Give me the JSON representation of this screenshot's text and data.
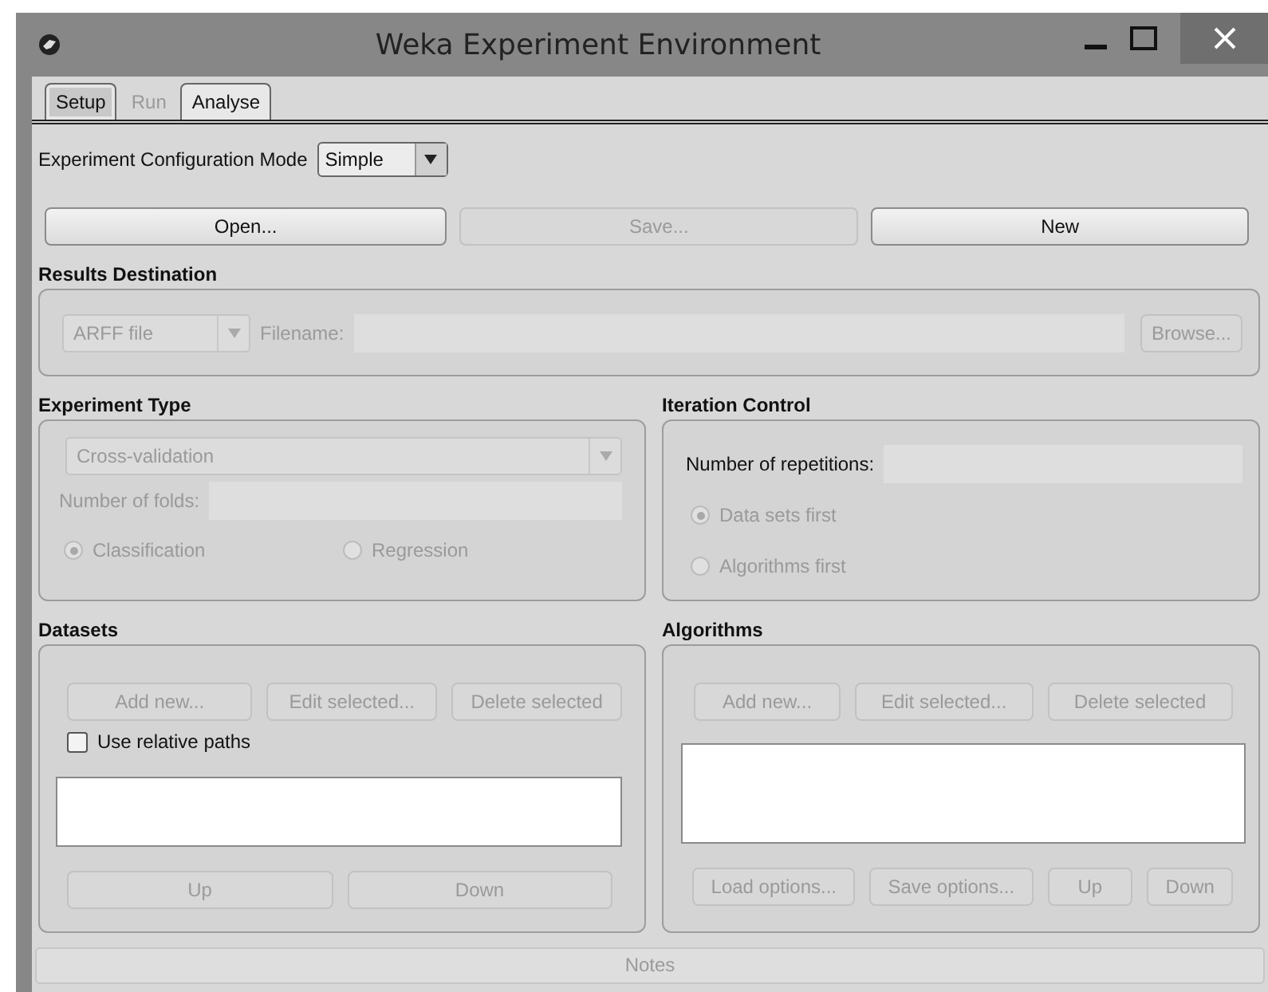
{
  "window": {
    "title": "Weka Experiment Environment"
  },
  "tabs": [
    {
      "label": "Setup",
      "selected": true,
      "disabled": false
    },
    {
      "label": "Run",
      "selected": false,
      "disabled": true
    },
    {
      "label": "Analyse",
      "selected": false,
      "disabled": false
    }
  ],
  "config_mode": {
    "label": "Experiment Configuration Mode",
    "value": "Simple"
  },
  "file_buttons": [
    {
      "label": "Open...",
      "disabled": false
    },
    {
      "label": "Save...",
      "disabled": true
    },
    {
      "label": "New",
      "disabled": false
    }
  ],
  "results_destination": {
    "title": "Results Destination",
    "type": "ARFF file",
    "filename_label": "Filename:",
    "browse": "Browse...",
    "disabled": true
  },
  "experiment_type": {
    "title": "Experiment Type",
    "type": "Cross-validation",
    "folds_label": "Number of folds:",
    "disabled": true,
    "options": [
      {
        "label": "Classification",
        "selected": true
      },
      {
        "label": "Regression",
        "selected": false
      }
    ]
  },
  "iteration_control": {
    "title": "Iteration Control",
    "repetitions_label": "Number of repetitions:",
    "disabled": true,
    "order": [
      {
        "label": "Data sets first",
        "selected": true
      },
      {
        "label": "Algorithms first",
        "selected": false
      }
    ]
  },
  "datasets": {
    "title": "Datasets",
    "buttons": [
      {
        "label": "Add new...",
        "disabled": true
      },
      {
        "label": "Edit selected...",
        "disabled": true
      },
      {
        "label": "Delete selected",
        "disabled": true
      }
    ],
    "relative_paths": {
      "label": "Use relative paths",
      "checked": false
    },
    "lower_buttons": [
      {
        "label": "Up",
        "disabled": true
      },
      {
        "label": "Down",
        "disabled": true
      }
    ]
  },
  "algorithms": {
    "title": "Algorithms",
    "buttons": [
      {
        "label": "Add new...",
        "disabled": true
      },
      {
        "label": "Edit selected...",
        "disabled": true
      },
      {
        "label": "Delete selected",
        "disabled": true
      }
    ],
    "lower_buttons": [
      {
        "label": "Load options...",
        "disabled": true
      },
      {
        "label": "Save options...",
        "disabled": true
      },
      {
        "label": "Up",
        "disabled": true
      },
      {
        "label": "Down",
        "disabled": true
      }
    ]
  },
  "notes": {
    "label": "Notes"
  }
}
